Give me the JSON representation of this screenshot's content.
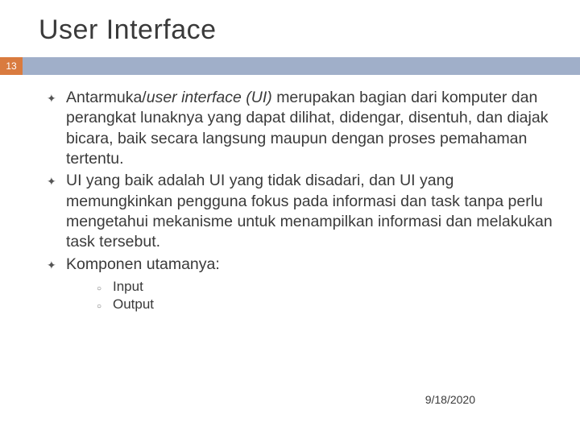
{
  "title": "User Interface",
  "slide_number": "13",
  "bullets": [
    {
      "pre": "Antarmuka/",
      "ital": "user interface (UI) ",
      "post": "merupakan bagian dari komputer dan perangkat lunaknya yang dapat dilihat, didengar, disentuh, dan diajak bicara, baik secara langsung maupun dengan proses pemahaman tertentu."
    },
    {
      "text": "UI yang baik adalah UI yang tidak disadari, dan UI yang memungkinkan pengguna fokus pada informasi dan task tanpa perlu mengetahui mekanisme untuk menampilkan informasi dan melakukan task tersebut."
    },
    {
      "text": "Komponen utamanya:"
    }
  ],
  "sub_bullets": [
    "Input",
    "Output"
  ],
  "date": "9/18/2020"
}
